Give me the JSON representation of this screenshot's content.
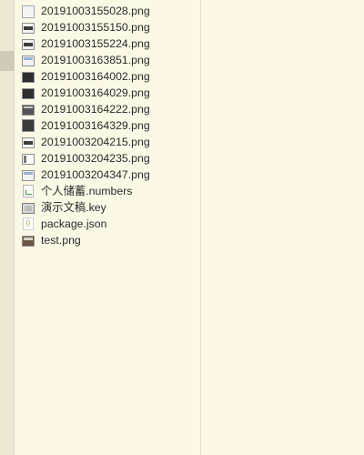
{
  "files": [
    {
      "name": "20191003155028.png",
      "icon": "png-blank-icon"
    },
    {
      "name": "20191003155150.png",
      "icon": "png-thumbnail-icon"
    },
    {
      "name": "20191003155224.png",
      "icon": "png-thumbnail-icon"
    },
    {
      "name": "20191003163851.png",
      "icon": "png-window-icon"
    },
    {
      "name": "20191003164002.png",
      "icon": "png-thumbnail-icon"
    },
    {
      "name": "20191003164029.png",
      "icon": "png-thumbnail-icon"
    },
    {
      "name": "20191003164222.png",
      "icon": "png-thumbnail-icon"
    },
    {
      "name": "20191003164329.png",
      "icon": "png-dark-icon"
    },
    {
      "name": "20191003204215.png",
      "icon": "png-thumbnail-icon"
    },
    {
      "name": "20191003204235.png",
      "icon": "png-window-icon"
    },
    {
      "name": "20191003204347.png",
      "icon": "png-thumbnail-icon"
    },
    {
      "name": "个人储蓄.numbers",
      "icon": "numbers-document-icon"
    },
    {
      "name": "演示文稿.key",
      "icon": "keynote-document-icon"
    },
    {
      "name": "package.json",
      "icon": "json-document-icon"
    },
    {
      "name": "test.png",
      "icon": "png-photo-icon"
    }
  ],
  "json_icon_glyph": "{}",
  "colors": {
    "background": "#fcf8e6",
    "rail": "#ece8d4",
    "rail_selection": "#cfcbb8",
    "text": "#2a2a2a"
  }
}
